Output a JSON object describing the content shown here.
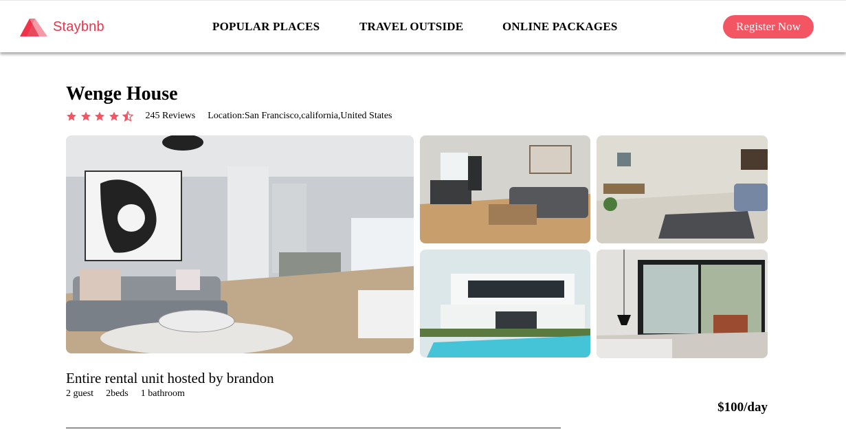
{
  "header": {
    "brand": "Staybnb",
    "nav": [
      "POPULAR PLACES",
      "TRAVEL OUTSIDE",
      "ONLINE PACKAGES"
    ],
    "register_label": "Register Now"
  },
  "listing": {
    "title": "Wenge House",
    "rating": 4.5,
    "rating_max": 5,
    "reviews": "245 Reviews",
    "location": "Location:San Francisco,california,United States",
    "host_line": "Entire rental unit hosted by brandon",
    "specs": [
      "2 guest",
      "2beds",
      "1 bathroom"
    ],
    "price": "$100/day"
  },
  "colors": {
    "brand": "#f0324a",
    "star": "#f45563",
    "button": "#f45563"
  }
}
